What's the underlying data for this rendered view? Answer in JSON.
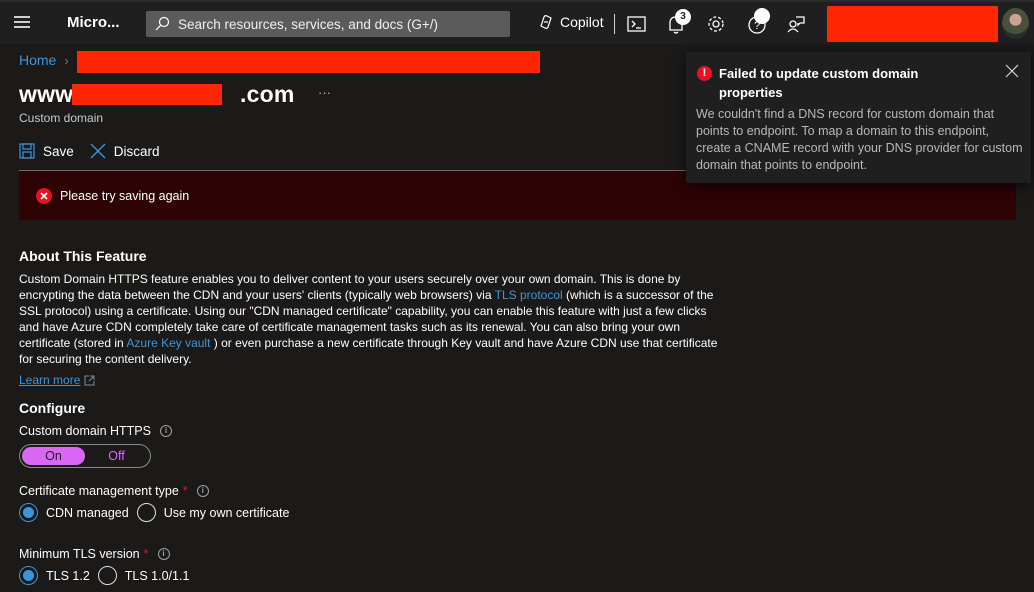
{
  "topbar": {
    "brand": "Micro...",
    "search_placeholder": "Search resources, services, and docs (G+/)",
    "copilot_label": "Copilot",
    "notification_count": "3",
    "icons": [
      "menu-icon",
      "search-icon",
      "copilot-icon",
      "cloud-shell-icon",
      "bell-icon",
      "gear-icon",
      "help-icon",
      "feedback-icon"
    ]
  },
  "breadcrumb": {
    "home": "Home",
    "separator": "›"
  },
  "page": {
    "title_prefix": "www.",
    "title_suffix": ".com",
    "subtitle": "Custom domain",
    "more": "···"
  },
  "commands": {
    "save": "Save",
    "discard": "Discard"
  },
  "error_banner": {
    "message": "Please try saving again"
  },
  "toast": {
    "title": "Failed to update custom domain properties",
    "body": "We couldn't find a DNS record for custom domain that points to endpoint. To map a domain to this endpoint, create a CNAME record with your DNS provider for custom domain that points to endpoint."
  },
  "about": {
    "heading": "About This Feature",
    "text_1": "Custom Domain HTTPS feature enables you to deliver content to your users securely over your own domain. This is done by encrypting the data between the CDN and your users' clients (typically web browsers) via ",
    "link_tls": "TLS protocol",
    "text_2": " (which is a successor of the SSL protocol) using a certificate. Using our \"CDN managed certificate\" capability, you can enable this feature with just a few clicks and have Azure CDN completely take care of certificate management tasks such as its renewal. You can also bring your own certificate (stored in ",
    "link_kv": "Azure Key vault",
    "text_3": " ) or even purchase a new certificate through Key vault and have Azure CDN use that certificate for securing the content delivery.",
    "learn_more": "Learn more"
  },
  "configure": {
    "heading": "Configure",
    "https_label": "Custom domain HTTPS",
    "https_on": "On",
    "https_off": "Off",
    "https_value": "On",
    "cert_label": "Certificate management type",
    "cert_required": "*",
    "cert_options": [
      "CDN managed",
      "Use my own certificate"
    ],
    "cert_selected": "CDN managed",
    "tls_label": "Minimum TLS version",
    "tls_required": "*",
    "tls_options": [
      "TLS 1.2",
      "TLS 1.0/1.1"
    ],
    "tls_selected": "TLS 1.2"
  },
  "colors": {
    "accent": "#3a96dd",
    "toggle": "#d966f5",
    "error": "#e81123",
    "error_banner_bg": "#2e0306",
    "redaction": "#ff2600"
  }
}
